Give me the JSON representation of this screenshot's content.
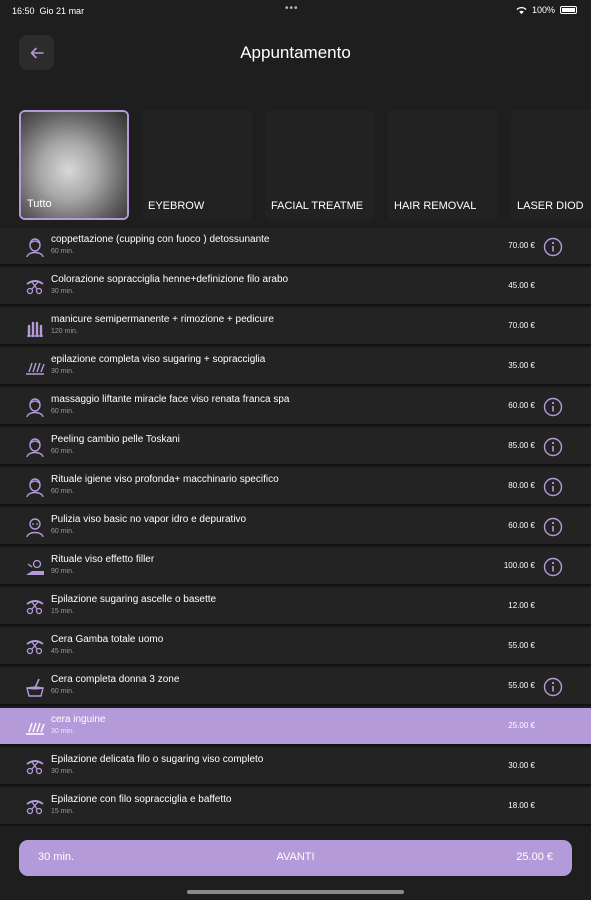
{
  "status_bar": {
    "time": "16:50",
    "date": "Gio 21 mar",
    "dots": "•••",
    "battery": "100%"
  },
  "header": {
    "back_icon": "arrow-left-icon",
    "title": "Appuntamento"
  },
  "categories": [
    {
      "label": "Tutto",
      "selected": true
    },
    {
      "label": "EYEBROW"
    },
    {
      "label": "FACIAL TREATME"
    },
    {
      "label": "HAIR REMOVAL"
    },
    {
      "label": "LASER DIOD"
    }
  ],
  "services": [
    {
      "name": "coppettazione (cupping con fuoco ) detossunante",
      "duration": "60 min.",
      "price": "70.00 €",
      "icon": "face-treatment-icon",
      "info": true
    },
    {
      "name": "Colorazione sopracciglia henne+definizione filo arabo",
      "duration": "30 min.",
      "price": "45.00 €",
      "icon": "eyebrow-tools-icon",
      "info": false
    },
    {
      "name": "manicure semipermanente + rimozione + pedicure",
      "duration": "120 min.",
      "price": "70.00 €",
      "icon": "manicure-icon",
      "info": false
    },
    {
      "name": "epilazione completa viso sugaring + sopracciglia",
      "duration": "30 min.",
      "price": "35.00 €",
      "icon": "hair-removal-icon",
      "info": false
    },
    {
      "name": "massaggio liftante miracle face viso renata franca spa",
      "duration": "60 min.",
      "price": "60.00 €",
      "icon": "face-treatment-icon",
      "info": true
    },
    {
      "name": "Peeling cambio pelle Toskani",
      "duration": "60 min.",
      "price": "85.00 €",
      "icon": "face-treatment-icon",
      "info": true
    },
    {
      "name": "Rituale igiene  viso  profonda+  macchinario specifico",
      "duration": "60 min.",
      "price": "80.00 €",
      "icon": "face-treatment-icon",
      "info": true
    },
    {
      "name": "Pulizia  viso basic no vapor idro e depurativo",
      "duration": "60 min.",
      "price": "60.00 €",
      "icon": "face-cleansing-icon",
      "info": true
    },
    {
      "name": "Rituale viso effetto filler",
      "duration": "90 min.",
      "price": "100.00 €",
      "icon": "face-massage-icon",
      "info": true
    },
    {
      "name": "Epilazione sugaring ascelle o basette",
      "duration": "15 min.",
      "price": "12.00 €",
      "icon": "eyebrow-tools-icon",
      "info": false
    },
    {
      "name": "Cera Gamba totale uomo",
      "duration": "45 min.",
      "price": "55.00 €",
      "icon": "eyebrow-tools-icon",
      "info": false
    },
    {
      "name": "Cera completa donna 3 zone",
      "duration": "60 min.",
      "price": "55.00 €",
      "icon": "wax-pot-icon",
      "info": true
    },
    {
      "name": "cera inguine",
      "duration": "30 min.",
      "price": "25.00 €",
      "icon": "hair-removal-icon",
      "info": false,
      "selected": true
    },
    {
      "name": "Epilazione delicata filo o sugaring viso completo",
      "duration": "30 min.",
      "price": "30.00 €",
      "icon": "eyebrow-tools-icon",
      "info": false
    },
    {
      "name": "Epilazione con filo sopracciglia e baffetto",
      "duration": "15 min.",
      "price": "18.00 €",
      "icon": "eyebrow-tools-icon",
      "info": false
    }
  ],
  "footer": {
    "duration": "30 min.",
    "next_label": "AVANTI",
    "total": "25.00 €"
  },
  "colors": {
    "background": "#1e1e1e",
    "row": "#232323",
    "accent": "#b49ad8"
  }
}
